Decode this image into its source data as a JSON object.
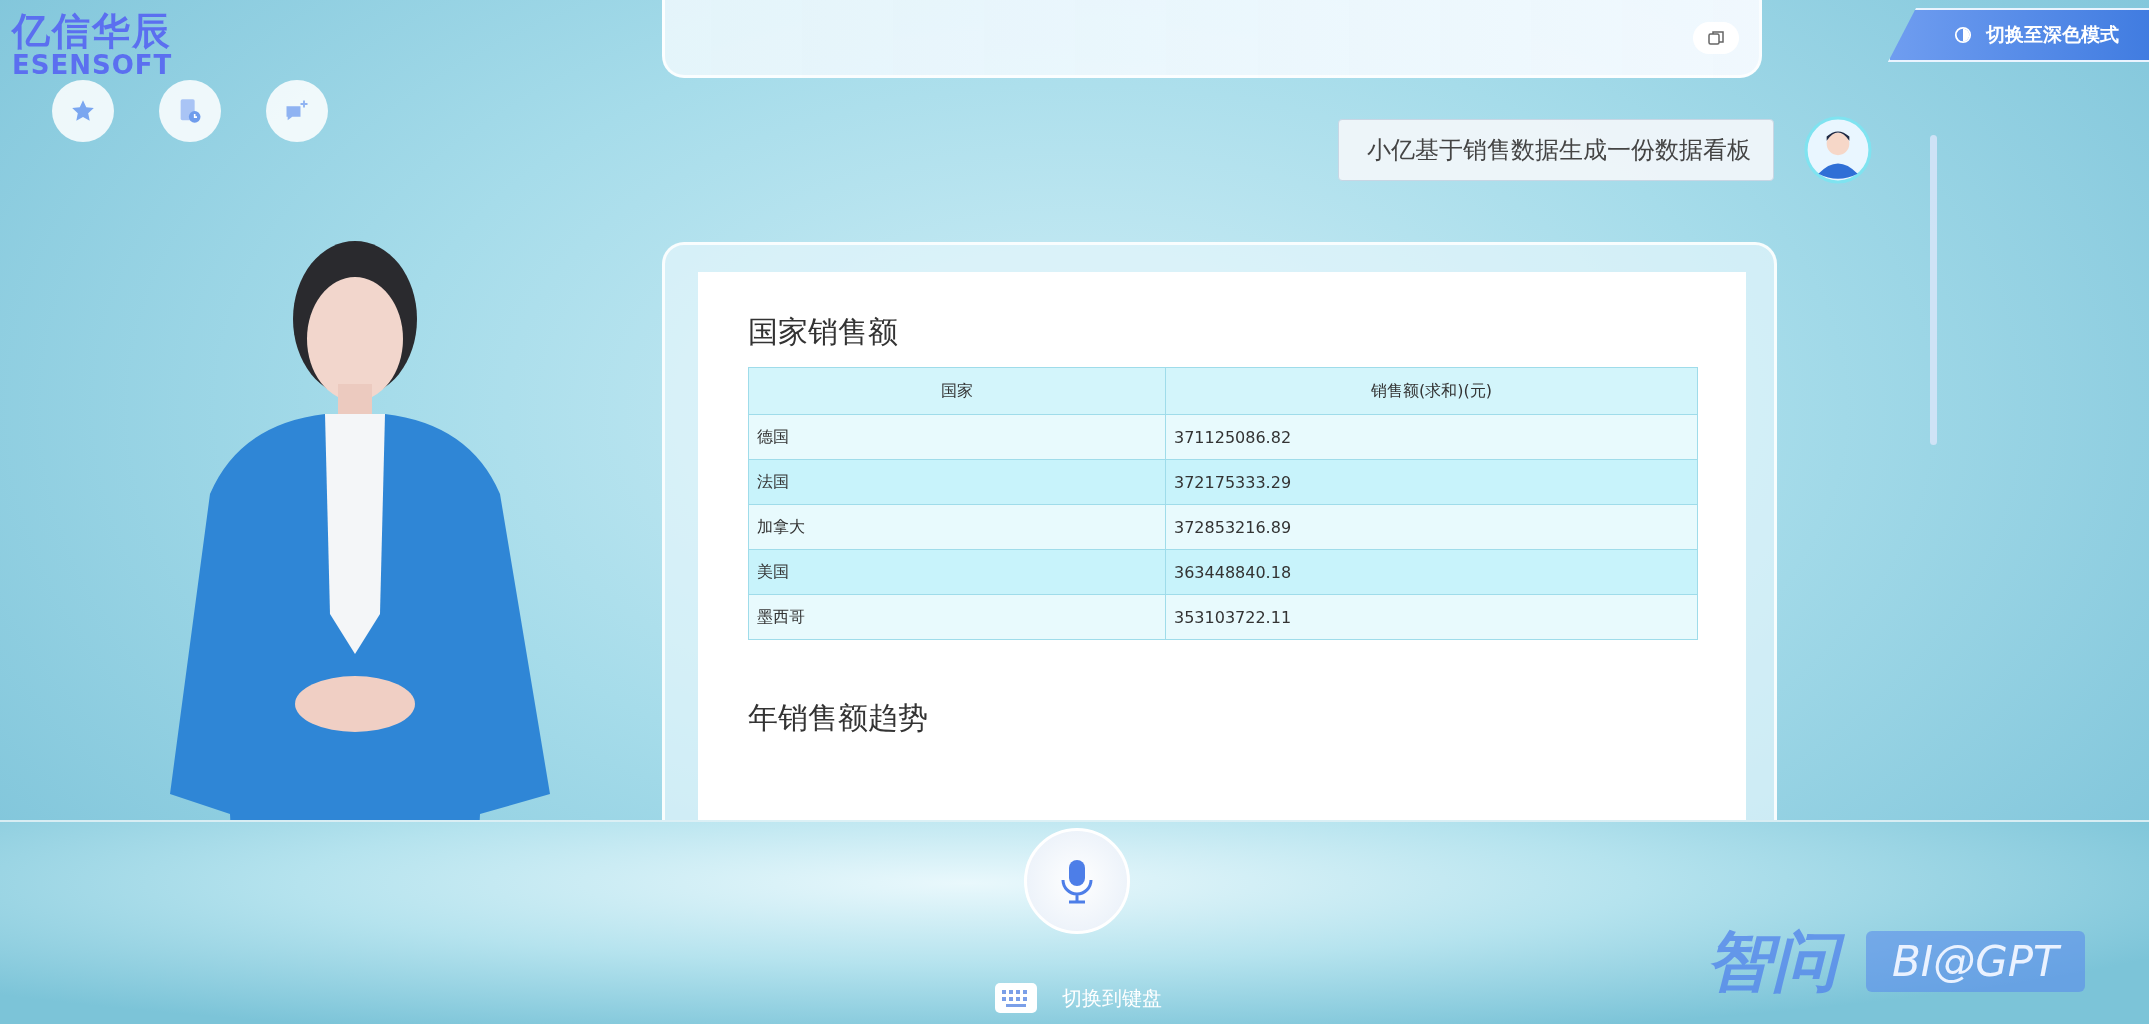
{
  "brand": {
    "name_cn": "亿信华辰",
    "name_en": "ESENSOFT"
  },
  "theme_button": {
    "label": "切换至深色模式"
  },
  "chat": {
    "user_message": "小亿基于销售数据生成一份数据看板",
    "answer": {
      "sections": [
        {
          "title": "国家销售额",
          "table": {
            "columns": [
              "国家",
              "销售额(求和)(元)"
            ],
            "rows": [
              [
                "德国",
                "371125086.82"
              ],
              [
                "法国",
                "372175333.29"
              ],
              [
                "加拿大",
                "372853216.89"
              ],
              [
                "美国",
                "363448840.18"
              ],
              [
                "墨西哥",
                "353103722.11"
              ]
            ]
          }
        },
        {
          "title": "年销售额趋势"
        }
      ]
    }
  },
  "bottom_bar": {
    "switch_label": "切换到键盘"
  },
  "product_badge": {
    "name": "智问",
    "tag": "BI@GPT"
  }
}
